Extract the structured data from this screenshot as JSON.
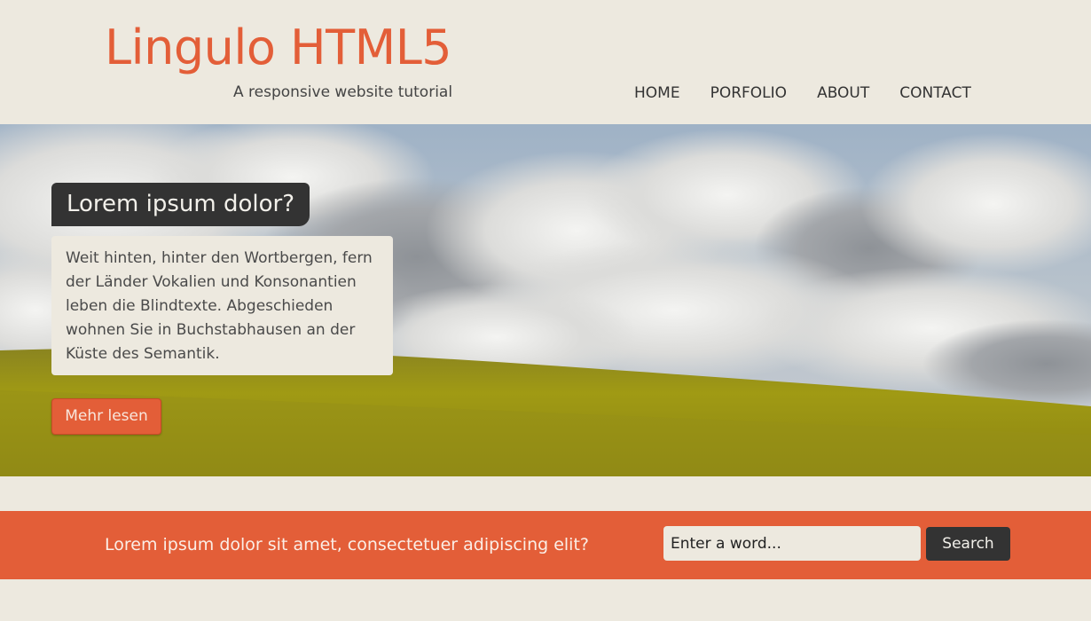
{
  "header": {
    "logo_title": "Lingulo HTML5",
    "tagline": "A responsive website tutorial",
    "nav": [
      {
        "label": "HOME"
      },
      {
        "label": "PORFOLIO"
      },
      {
        "label": "ABOUT"
      },
      {
        "label": "CONTACT"
      }
    ]
  },
  "hero": {
    "title": "Lorem ipsum dolor?",
    "body": "Weit hinten, hinter den Wortbergen, fern der Länder Vokalien und Konsonantien leben die Blindtexte. Abgeschieden wohnen Sie in Buchstabhausen an der Küste des Semantik.",
    "button_label": "Mehr lesen"
  },
  "band": {
    "text": "Lorem ipsum dolor sit amet, consectetuer adipiscing elit?",
    "search_placeholder": "Enter a word...",
    "search_button_label": "Search"
  },
  "colors": {
    "accent": "#e35e38",
    "dark": "#333333",
    "background": "#ede9df"
  }
}
